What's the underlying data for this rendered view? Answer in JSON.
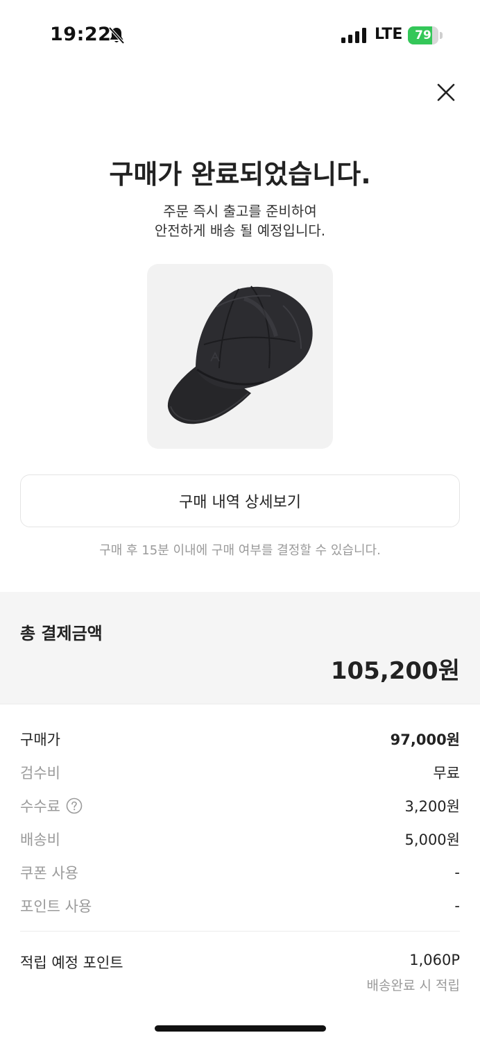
{
  "status_bar": {
    "time": "19:22",
    "network": "LTE",
    "battery_level": "79",
    "battery_fraction": 0.79,
    "battery_color": "#34c759",
    "icons": [
      "bell-slash-icon",
      "signal-icon",
      "battery-icon"
    ]
  },
  "header": {
    "close_icon": "close-icon",
    "title": "구매가 완료되었습니다.",
    "subtitle_line1": "주문 즉시 출고를 준비하여",
    "subtitle_line2": "안전하게 배송 될 예정입니다."
  },
  "product": {
    "image": "black-cap-image"
  },
  "actions": {
    "detail_button_label": "구매 내역 상세보기",
    "notice": "구매 후 15분 이내에 구매 여부를 결정할 수 있습니다."
  },
  "total": {
    "label": "총 결제금액",
    "value": "105,200원"
  },
  "breakdown": {
    "rows": [
      {
        "label": "구매가",
        "value": "97,000원"
      },
      {
        "label": "검수비",
        "value": "무료"
      },
      {
        "label": "수수료",
        "value": "3,200원",
        "icon": "help-circle-icon"
      },
      {
        "label": "배송비",
        "value": "5,000원"
      },
      {
        "label": "쿠폰 사용",
        "value": "-"
      },
      {
        "label": "포인트 사용",
        "value": "-"
      }
    ]
  },
  "points": {
    "label": "적립 예정 포인트",
    "value": "1,060P",
    "note": "배송완료 시 적립"
  }
}
